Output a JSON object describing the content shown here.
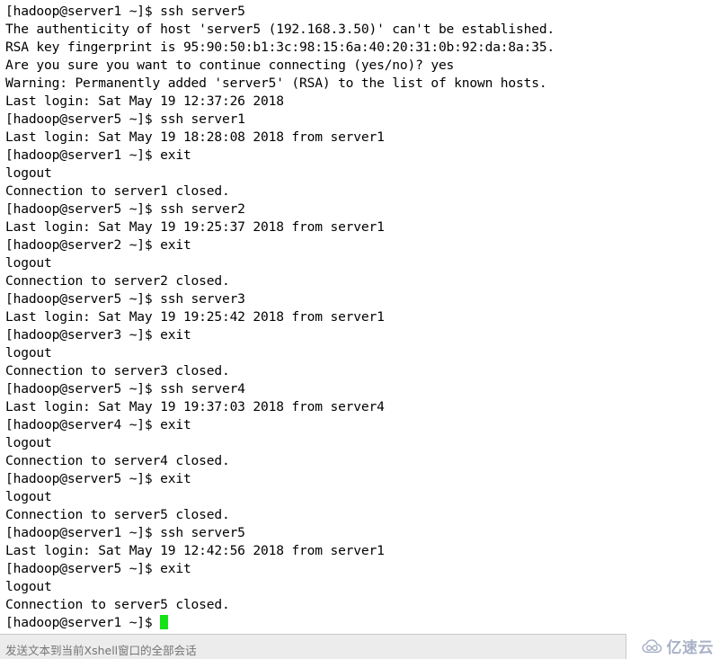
{
  "terminal": {
    "lines": [
      "[hadoop@server1 ~]$ ssh server5",
      "The authenticity of host 'server5 (192.168.3.50)' can't be established.",
      "RSA key fingerprint is 95:90:50:b1:3c:98:15:6a:40:20:31:0b:92:da:8a:35.",
      "Are you sure you want to continue connecting (yes/no)? yes",
      "Warning: Permanently added 'server5' (RSA) to the list of known hosts.",
      "Last login: Sat May 19 12:37:26 2018",
      "[hadoop@server5 ~]$ ssh server1",
      "Last login: Sat May 19 18:28:08 2018 from server1",
      "[hadoop@server1 ~]$ exit",
      "logout",
      "Connection to server1 closed.",
      "[hadoop@server5 ~]$ ssh server2",
      "Last login: Sat May 19 19:25:37 2018 from server1",
      "[hadoop@server2 ~]$ exit",
      "logout",
      "Connection to server2 closed.",
      "[hadoop@server5 ~]$ ssh server3",
      "Last login: Sat May 19 19:25:42 2018 from server1",
      "[hadoop@server3 ~]$ exit",
      "logout",
      "Connection to server3 closed.",
      "[hadoop@server5 ~]$ ssh server4",
      "Last login: Sat May 19 19:37:03 2018 from server4",
      "[hadoop@server4 ~]$ exit",
      "logout",
      "Connection to server4 closed.",
      "[hadoop@server5 ~]$ exit",
      "logout",
      "Connection to server5 closed.",
      "[hadoop@server1 ~]$ ssh server5",
      "Last login: Sat May 19 12:42:56 2018 from server1",
      "[hadoop@server5 ~]$ exit",
      "logout",
      "Connection to server5 closed."
    ],
    "prompt_line": "[hadoop@server1 ~]$ ",
    "cursor_color": "#15e215",
    "text_color": "#000000",
    "background_color": "#ffffff"
  },
  "statusbar": {
    "send_to_all_placeholder": "发送文本到当前Xshell窗口的全部会话",
    "send_to_all_value": "",
    "background_color": "#ececed"
  },
  "watermark": {
    "text": "亿速云",
    "icon": "cloud-icon",
    "color": "#9aa4bd"
  }
}
